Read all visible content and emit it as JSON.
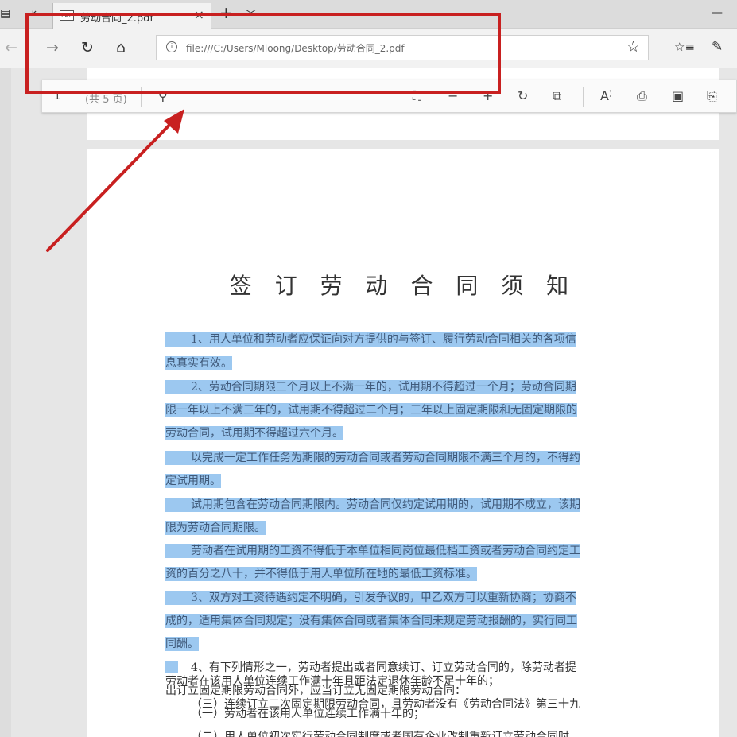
{
  "browser": {
    "tab": {
      "icon": "pdf-icon",
      "title": "劳动合同_2.pdf"
    },
    "address": {
      "url": "file:///C:/Users/Mloong/Desktop/劳动合同_2.pdf"
    }
  },
  "pdf_toolbar": {
    "page_number": "1",
    "page_total": "(共 5 页)",
    "read_aloud_label": "A⁾"
  },
  "document": {
    "title": "签 订 劳 动 合 同 须 知",
    "lines": [
      "1、用人单位和劳动者应保证向对方提供的与签订、履行劳动合同相关的各项信",
      "息真实有效。",
      "2、劳动合同期限三个月以上不满一年的，试用期不得超过一个月；劳动合同期",
      "限一年以上不满三年的，试用期不得超过二个月；三年以上固定期限和无固定期限的",
      "劳动合同，试用期不得超过六个月。",
      "以完成一定工作任务为期限的劳动合同或者劳动合同期限不满三个月的，不得约",
      "定试用期。",
      "试用期包含在劳动合同期限内。劳动合同仅约定试用期的，试用期不成立，该期",
      "限为劳动合同期限。",
      "劳动者在试用期的工资不得低于本单位相同岗位最低档工资或者劳动合同约定工",
      "资的百分之八十，并不得低于用人单位所在地的最低工资标准。",
      "3、双方对工资待遇约定不明确，引发争议的，甲乙双方可以重新协商；协商不",
      "成的，适用集体合同规定；没有集体合同或者集体合同未规定劳动报酬的，实行同工",
      "同酬。",
      "4、有下列情形之一，劳动者提出或者同意续订、订立劳动合同的，除劳动者提",
      "出订立固定期限劳动合同外，应当订立无固定期限劳动合同：",
      "（一）劳动者在该用人单位连续工作满十年的；",
      "（二）用人单位初次实行劳动合同制度或者国有企业改制重新订立劳动合同时，",
      "劳动者在该用人单位连续工作满十年且距法定退休年龄不足十年的；",
      "（三）连续订立二次固定期限劳动合同，且劳动者没有《劳动合同法》第三十九"
    ]
  },
  "colors": {
    "selection": "#9cc8f0",
    "annotation": "#c82020"
  }
}
